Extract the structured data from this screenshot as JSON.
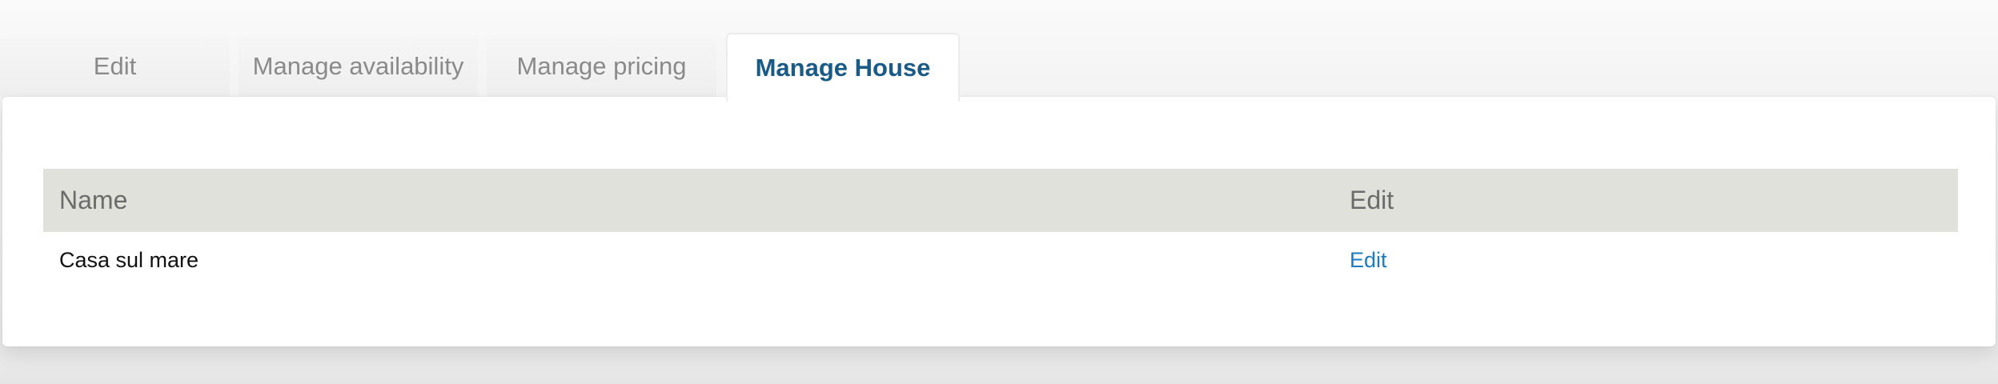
{
  "tabs": [
    {
      "label": "Edit",
      "active": false
    },
    {
      "label": "Manage availability",
      "active": false
    },
    {
      "label": "Manage pricing",
      "active": false
    },
    {
      "label": "Manage House",
      "active": true
    }
  ],
  "table": {
    "headers": {
      "name": "Name",
      "edit": "Edit"
    },
    "rows": [
      {
        "name": "Casa sul mare",
        "edit": "Edit"
      }
    ]
  },
  "colors": {
    "active_tab_text": "#1a5a86",
    "link": "#1f7bc0",
    "table_header_bg": "#e1e1dc"
  }
}
